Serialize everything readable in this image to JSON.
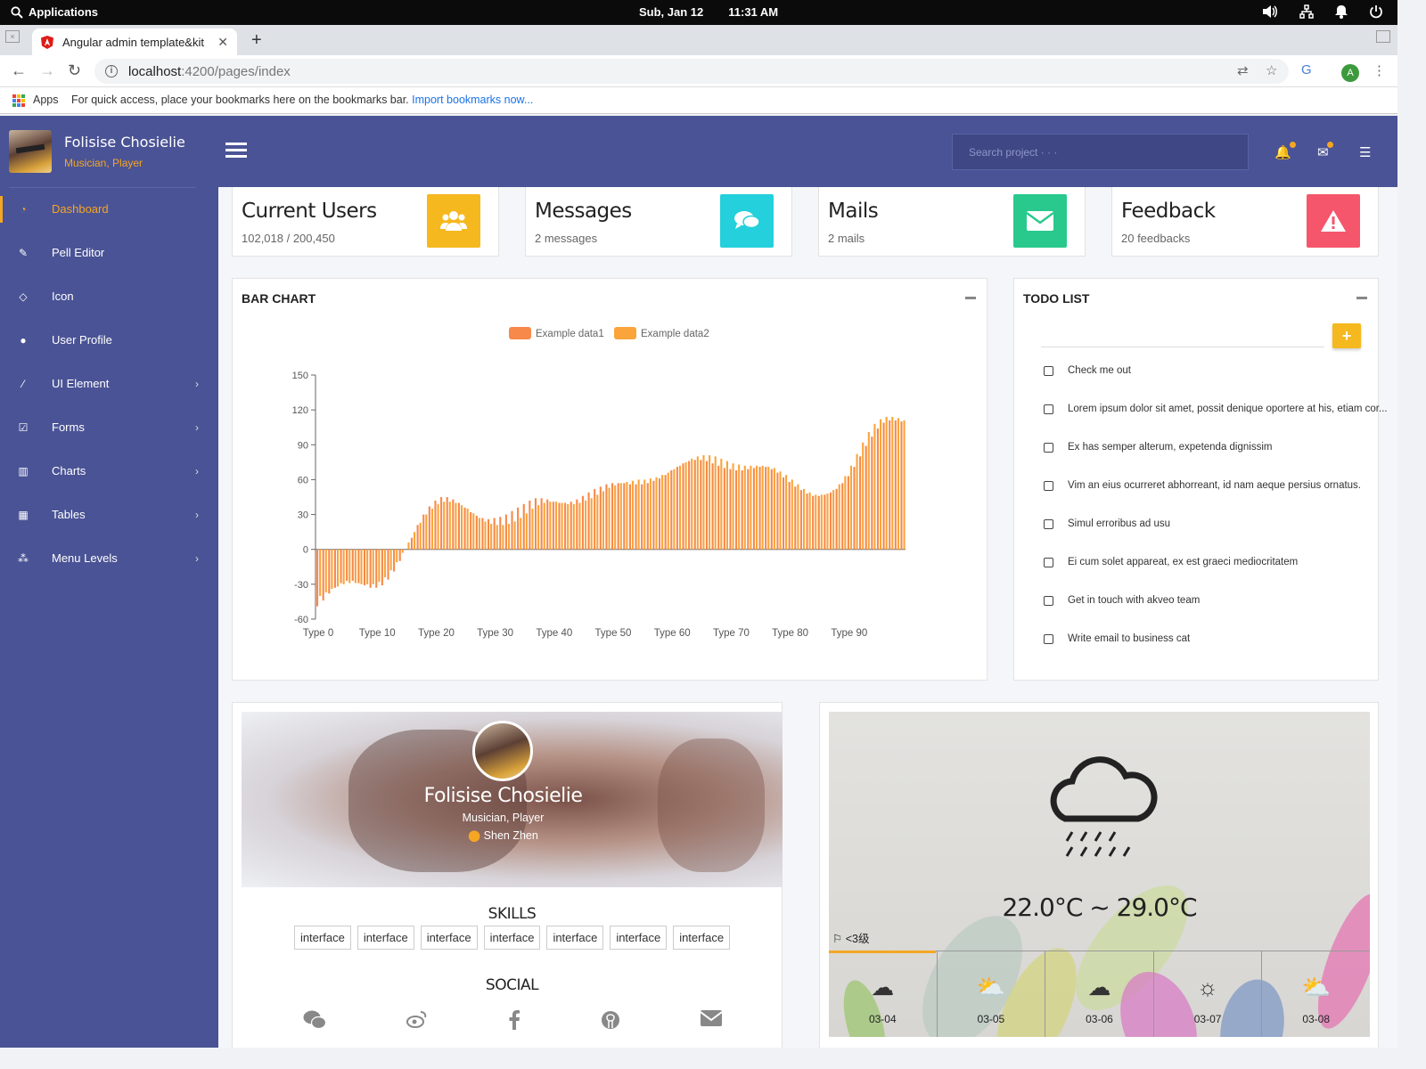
{
  "os": {
    "apps_label": "Applications",
    "date": "Sub, Jan 12",
    "time": "11:31 AM"
  },
  "browser": {
    "tab_title": "Angular admin template&kit",
    "url_host": "localhost",
    "url_path": ":4200/pages/index",
    "bookmarks_apps": "Apps",
    "bookmarks_hint": "For quick access, place your bookmarks here on the bookmarks bar.",
    "bookmarks_import": "Import bookmarks now...",
    "profile_initial": "A"
  },
  "sidebar": {
    "user_name": "Folisise Chosielie",
    "user_role": "Musician, Player",
    "items": [
      {
        "label": "Dashboard",
        "icon": "dashboard-icon",
        "active": true
      },
      {
        "label": "Pell Editor",
        "icon": "pencil-icon"
      },
      {
        "label": "Icon",
        "icon": "diamond-icon"
      },
      {
        "label": "User Profile",
        "icon": "user-icon"
      },
      {
        "label": "UI Element",
        "icon": "brush-icon",
        "has_children": true
      },
      {
        "label": "Forms",
        "icon": "check-square-icon",
        "has_children": true
      },
      {
        "label": "Charts",
        "icon": "bar-chart-icon",
        "has_children": true
      },
      {
        "label": "Tables",
        "icon": "table-icon",
        "has_children": true
      },
      {
        "label": "Menu Levels",
        "icon": "sitemap-icon",
        "has_children": true
      }
    ]
  },
  "topbar": {
    "search_placeholder": "Search project · · ·"
  },
  "stats": [
    {
      "title": "Current Users",
      "sub": "102,018 / 200,450",
      "color": "#f5b81f",
      "icon": "users-icon"
    },
    {
      "title": "Messages",
      "sub": "2 messages",
      "color": "#24d0db",
      "icon": "comments-icon"
    },
    {
      "title": "Mails",
      "sub": "2 mails",
      "color": "#29c98d",
      "icon": "envelope-icon"
    },
    {
      "title": "Feedback",
      "sub": "20 feedbacks",
      "color": "#f5566c",
      "icon": "warning-icon"
    }
  ],
  "bar_panel": {
    "title": "BAR CHART"
  },
  "chart_data": {
    "type": "bar",
    "legend": [
      "Example data1",
      "Example data2"
    ],
    "legend_position": "top-center",
    "colors": [
      "#f7894b",
      "#f9a53b"
    ],
    "ylim": [
      -60,
      150
    ],
    "yticks": [
      "150",
      "120",
      "90",
      "60",
      "30",
      "0",
      "-30",
      "-60"
    ],
    "xticks": [
      "Type 0",
      "Type 10",
      "Type 20",
      "Type 30",
      "Type 40",
      "Type 50",
      "Type 60",
      "Type 70",
      "Type 80",
      "Type 90"
    ],
    "categories_count": 100,
    "series": [
      {
        "name": "Example data1",
        "values": [
          -49,
          -44,
          -38,
          -33,
          -29,
          -27,
          -27,
          -29,
          -31,
          -33,
          -33,
          -31,
          -26,
          -19,
          -10,
          0,
          10,
          21,
          30,
          37,
          42,
          45,
          45,
          43,
          40,
          36,
          32,
          29,
          27,
          26,
          27,
          28,
          30,
          33,
          36,
          39,
          42,
          44,
          44,
          43,
          41,
          40,
          40,
          41,
          43,
          46,
          49,
          52,
          54,
          56,
          57,
          57,
          57,
          56,
          56,
          56,
          57,
          59,
          61,
          64,
          68,
          71,
          74,
          76,
          77,
          77,
          76,
          74,
          72,
          70,
          69,
          68,
          68,
          69,
          70,
          71,
          71,
          69,
          66,
          62,
          58,
          54,
          51,
          48,
          46,
          46,
          47,
          49,
          52,
          57,
          63,
          71,
          80,
          89,
          97,
          104,
          109,
          111,
          111,
          110
        ]
      },
      {
        "name": "Example data2",
        "values": [
          -40,
          -37,
          -34,
          -32,
          -30,
          -29,
          -29,
          -30,
          -30,
          -30,
          -28,
          -24,
          -18,
          -11,
          -3,
          6,
          15,
          23,
          30,
          35,
          39,
          41,
          41,
          40,
          38,
          35,
          31,
          27,
          24,
          22,
          21,
          21,
          22,
          24,
          27,
          31,
          35,
          38,
          40,
          41,
          41,
          40,
          39,
          39,
          40,
          42,
          44,
          47,
          50,
          53,
          55,
          57,
          58,
          59,
          60,
          60,
          61,
          62,
          64,
          66,
          69,
          72,
          75,
          78,
          80,
          81,
          81,
          80,
          78,
          76,
          74,
          73,
          72,
          72,
          72,
          72,
          71,
          70,
          67,
          64,
          60,
          56,
          52,
          49,
          47,
          47,
          48,
          51,
          56,
          63,
          72,
          82,
          92,
          101,
          108,
          112,
          114,
          114,
          113,
          111
        ]
      }
    ]
  },
  "todo": {
    "title": "TODO LIST",
    "add_label": "+",
    "items": [
      "Check me out",
      "Lorem ipsum dolor sit amet, possit denique oportere at his, etiam cor...",
      "Ex has semper alterum, expetenda dignissim",
      "Vim an eius ocurreret abhorreant, id nam aeque persius ornatus.",
      "Simul erroribus ad usu",
      "Ei cum solet appareat, ex est graeci mediocritatem",
      "Get in touch with akveo team",
      "Write email to business cat"
    ]
  },
  "profile_card": {
    "name": "Folisise Chosielie",
    "role": "Musician, Player",
    "location": "Shen Zhen",
    "skills_heading": "SKILLS",
    "skills": [
      "interface",
      "interface",
      "interface",
      "interface",
      "interface",
      "interface",
      "interface"
    ],
    "social_heading": "SOCIAL",
    "social": [
      "wechat-icon",
      "weibo-icon",
      "facebook-icon",
      "github-icon",
      "envelope-icon"
    ]
  },
  "weather": {
    "temp_range": "22.0°C ~ 29.0°C",
    "wind": "<3级",
    "forecast": [
      {
        "date": "03-04",
        "icon": "cloud-rain-icon"
      },
      {
        "date": "03-05",
        "icon": "cloud-sun-icon"
      },
      {
        "date": "03-06",
        "icon": "cloud-thunder-icon"
      },
      {
        "date": "03-07",
        "icon": "sun-icon"
      },
      {
        "date": "03-08",
        "icon": "cloud-sun-icon"
      }
    ]
  }
}
